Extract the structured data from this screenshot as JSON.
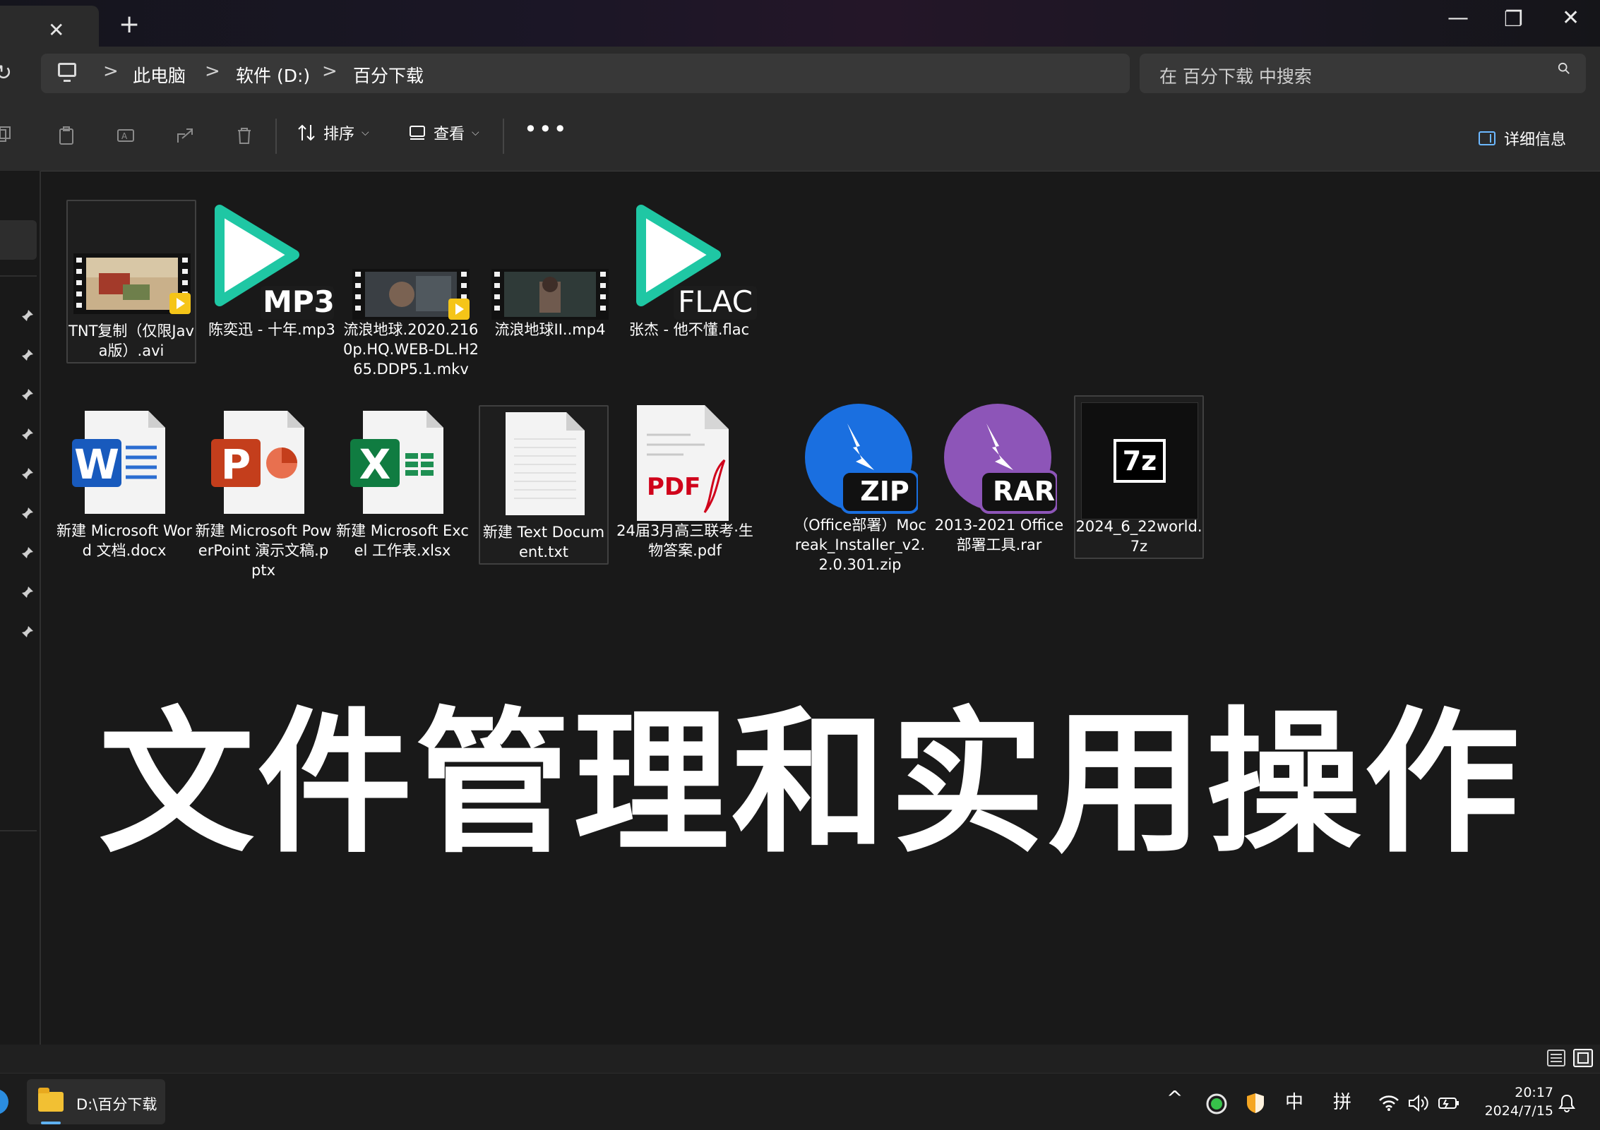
{
  "window": {
    "tab_close": "✕",
    "new_tab": "+",
    "minimize": "—",
    "restore": "❐",
    "close": "✕"
  },
  "address": {
    "crumbs": [
      "此电脑",
      "软件 (D:)",
      "百分下载"
    ],
    "separator": ">",
    "search_placeholder": "在 百分下载 中搜索"
  },
  "toolbar": {
    "sort_label": "排序",
    "view_label": "查看",
    "more": "•••",
    "details_label": "详细信息"
  },
  "files": [
    {
      "name": "TNT复制（仅限Java版）.avi",
      "type": "avi",
      "selected": true
    },
    {
      "name": "陈奕迅 - 十年.mp3",
      "type": "mp3",
      "badge": "MP3"
    },
    {
      "name": "流浪地球.2020.2160p.HQ.WEB-DL.H265.DDP5.1.mkv",
      "type": "mkv"
    },
    {
      "name": "流浪地球II..mp4",
      "type": "mp4"
    },
    {
      "name": "张杰 - 他不懂.flac",
      "type": "flac",
      "badge": "FLAC"
    },
    {
      "name": "新建 Microsoft Word 文档.docx",
      "type": "docx",
      "badge": "W"
    },
    {
      "name": "新建 Microsoft PowerPoint 演示文稿.pptx",
      "type": "pptx",
      "badge": "P"
    },
    {
      "name": "新建 Microsoft Excel 工作表.xlsx",
      "type": "xlsx",
      "badge": "X"
    },
    {
      "name": "新建 Text Document.txt",
      "type": "txt",
      "selected": true
    },
    {
      "name": "24届3月高三联考·生物答案.pdf",
      "type": "pdf",
      "badge": "PDF"
    },
    {
      "name": "（Office部署）Mocreak_Installer_v2.2.0.301.zip",
      "type": "zip",
      "badge": "ZIP"
    },
    {
      "name": "2013-2021 Office部署工具.rar",
      "type": "rar",
      "badge": "RAR"
    },
    {
      "name": "2024_6_22world.7z",
      "type": "7z",
      "badge": "7z",
      "selected": true
    }
  ],
  "overlay_title": "文件管理和实用操作",
  "taskbar": {
    "app_label": "D:\\百分下载",
    "tray_chevron": "^",
    "ime_lang": "中",
    "ime_mode": "拼",
    "time": "20:17",
    "date": "2024/7/15"
  },
  "colors": {
    "background": "#191919",
    "chrome": "#2b2b2b",
    "accent": "#5fb2f2",
    "media_teal": "#1fc7a4",
    "word": "#185abd",
    "powerpoint": "#c43e1c",
    "excel": "#107c41",
    "pdf_red": "#d0021b",
    "zip_blue": "#1a6fe0",
    "rar_purple": "#8d55b8"
  }
}
